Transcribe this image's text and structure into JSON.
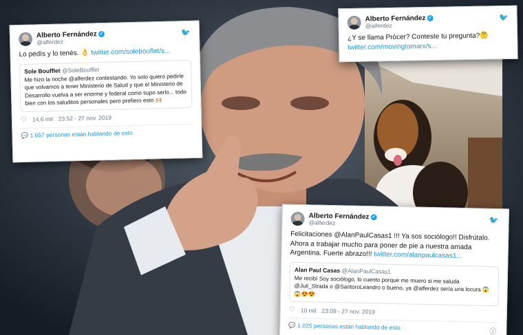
{
  "tweet_left": {
    "author": "Alberto Fernández",
    "handle": "@alferdez",
    "text": "Lo pedís y lo tenés. 👌",
    "link": "twitter.com/solebouflet/s...",
    "quote": {
      "author": "Sole Boufflet",
      "handle": "@SoleBoufflet",
      "text": "Me hizo la noche @alferdez contestando. Yo solo quiero pedirle que volvamos a tener Ministerio de Salud y que el Ministerio de Desarrollo vuelva a ser enorme y federal como supo serlo... todo bien con los saluditos personales pero prefiero esto 🙌🏼"
    },
    "likes": "14,6 mil",
    "timestamp": "23:52 - 27 nov. 2019",
    "talking": "1.657 personas están hablando de esto"
  },
  "tweet_right": {
    "author": "Alberto Fernández",
    "handle": "@alferdez",
    "text": "¿Y se llama Prócer? Conteste tu pregunta?🤔",
    "link": "twitter.com/movingtomarx/s..."
  },
  "tweet_bottom": {
    "author": "Alberto Fernández",
    "handle": "@alferdez",
    "text": "Felicitaciones @AlanPaulCasas1 !!! Ya sos sociólogo!! Disfrútalo. Ahora a trabajar mucho para poner de pie a nuestra amada Argentina. Fuerte abrazo!!!",
    "link": "twitter.com/alanpaulcasas1...",
    "quote": {
      "author": "Alan Paul Casas",
      "handle": "@AlanPaulCasas1",
      "text": "Me recibí Soy sociólogo, lo cuento porque me muero si me saluda @Juli_Strada o @SantoroLeandro o bueno, ya @alferdez sería una locura 😱😱😍😍"
    },
    "likes": "10 mil",
    "timestamp": "23:09 - 27 nov. 2019",
    "talking": "1.025 personas están hablando de esto"
  },
  "icons": {
    "bird": "🐦",
    "heart": "♡",
    "talk": "💬",
    "info": "ⓘ",
    "verified": "✓"
  }
}
